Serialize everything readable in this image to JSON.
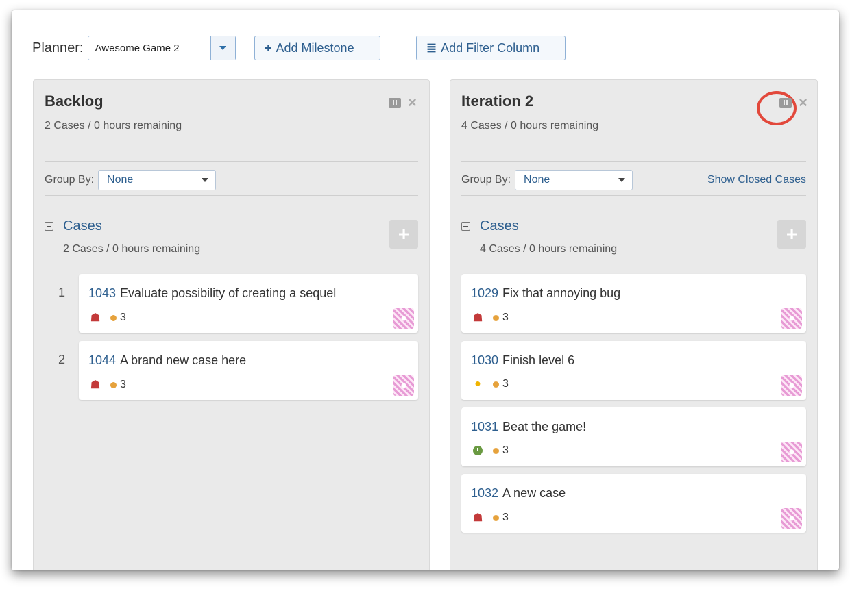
{
  "toolbar": {
    "planner_label": "Planner:",
    "planner_value": "Awesome Game 2",
    "add_milestone_icon": "+",
    "add_milestone_label": "Add Milestone",
    "add_filter_icon": "≣",
    "add_filter_label": "Add Filter Column"
  },
  "columns": [
    {
      "title": "Backlog",
      "summary": "2 Cases / 0 hours remaining",
      "group_by_label": "Group By:",
      "group_by_value": "None",
      "section_title": "Cases",
      "section_summary": "2 Cases / 0 hours remaining",
      "cards": [
        {
          "rank": "1",
          "id": "1043",
          "title": "Evaluate possibility of creating a sequel",
          "type": "bug-icon",
          "estimate": "3"
        },
        {
          "rank": "2",
          "id": "1044",
          "title": "A brand new case here",
          "type": "bug-icon",
          "estimate": "3"
        }
      ]
    },
    {
      "title": "Iteration 2",
      "summary": "4 Cases / 0 hours remaining",
      "group_by_label": "Group By:",
      "group_by_value": "None",
      "show_closed_label": "Show Closed Cases",
      "section_title": "Cases",
      "section_summary": "4 Cases / 0 hours remaining",
      "cards": [
        {
          "id": "1029",
          "title": "Fix that annoying bug",
          "type": "bug-icon",
          "estimate": "3"
        },
        {
          "id": "1030",
          "title": "Finish level 6",
          "type": "lightbulb-icon",
          "estimate": "3"
        },
        {
          "id": "1031",
          "title": "Beat the game!",
          "type": "clock-icon",
          "estimate": "3"
        },
        {
          "id": "1032",
          "title": "A new case",
          "type": "bug-icon",
          "estimate": "3"
        }
      ]
    }
  ],
  "colors": {
    "link_blue": "#2e5f8f",
    "highlight_red": "#e2483b",
    "column_bg": "#eaeaea",
    "estimate_dot": "#e6a23c"
  }
}
